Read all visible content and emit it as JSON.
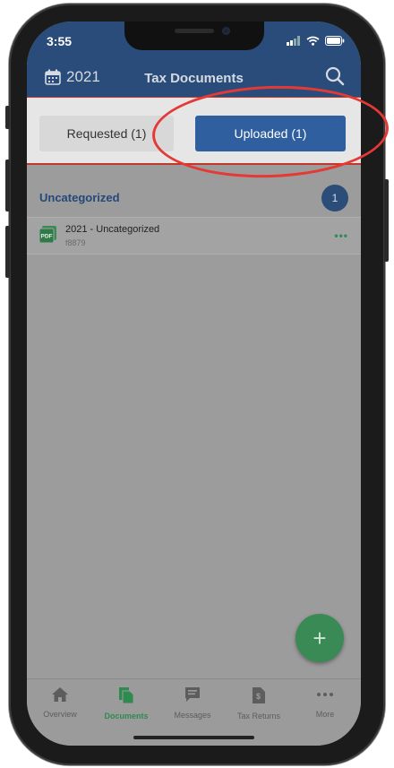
{
  "status": {
    "time": "3:55"
  },
  "header": {
    "year": "2021",
    "title": "Tax Documents"
  },
  "tabs": {
    "requested": "Requested (1)",
    "uploaded": "Uploaded (1)"
  },
  "section": {
    "title": "Uncategorized",
    "count": "1"
  },
  "document": {
    "title": "2021 - Uncategorized",
    "subtitle": "f8879",
    "more": "•••"
  },
  "fab": {
    "label": "+"
  },
  "nav": [
    {
      "label": "Overview",
      "icon": "home-icon"
    },
    {
      "label": "Documents",
      "icon": "documents-icon"
    },
    {
      "label": "Messages",
      "icon": "messages-icon"
    },
    {
      "label": "Tax Returns",
      "icon": "tax-returns-icon"
    },
    {
      "label": "More",
      "icon": "more-icon"
    }
  ],
  "colors": {
    "header": "#294c7a",
    "accent": "#2f5f9e",
    "green": "#3a8a56",
    "highlight": "#e53935"
  }
}
